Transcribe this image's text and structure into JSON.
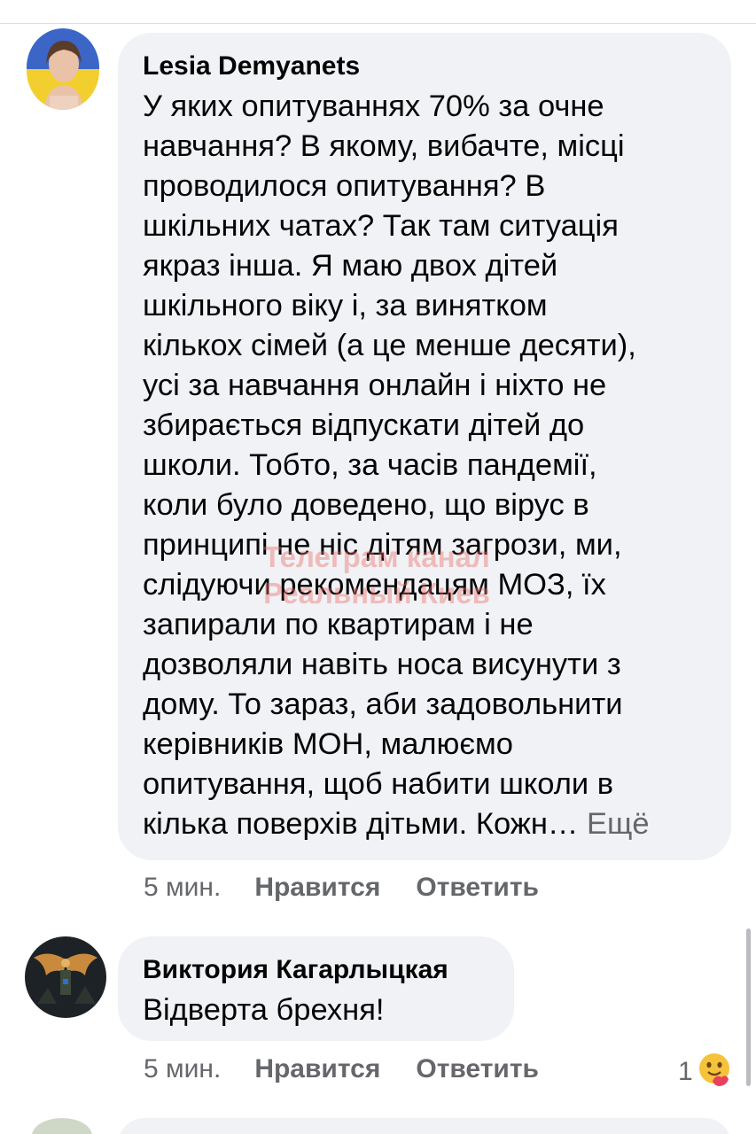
{
  "comments": [
    {
      "author": "Lesia Demyanets",
      "text_lines": [
        "У яких опитуваннях 70% за очне",
        "навчання? В якому, вибачте, місці",
        "проводилося опитування? В",
        "шкільних чатах? Так там ситуація",
        "якраз інша. Я маю двох дітей",
        "шкільного віку і, за винятком",
        "кількох сімей (а це менше десяти),",
        "усі за навчання онлайн і ніхто не",
        "збирається відпускати дітей до",
        "школи. Тобто, за часів пандемії,",
        "коли було доведено, що вірус в",
        "принципі не ніс дітям загрози, ми,",
        "слідуючи рекомендацям МОЗ,  їх",
        "запирали по квартирам і не",
        "дозволяли навіть носа висунути з",
        "дому. То зараз, аби задовольнити",
        "керівників МОН, малюємо",
        "опитування, щоб набити школи в",
        "кілька поверхів дітьми. Кожн…"
      ],
      "see_more": "Ещё",
      "time": "5 мин.",
      "like_label": "Нравится",
      "reply_label": "Ответить"
    },
    {
      "author": "Виктория Кагарлыцкая",
      "text": "Відверта брехня!",
      "time": "5 мин.",
      "like_label": "Нравится",
      "reply_label": "Ответить",
      "reaction_count": "1",
      "reaction_icon": "hugging-face-emoji-icon"
    }
  ],
  "watermark": {
    "line1": "Телеграм канал",
    "line2": "Реальный Киев"
  },
  "colors": {
    "bubble": "#f0f2f5",
    "secondary_text": "#65676b",
    "watermark": "#ee6e69"
  }
}
